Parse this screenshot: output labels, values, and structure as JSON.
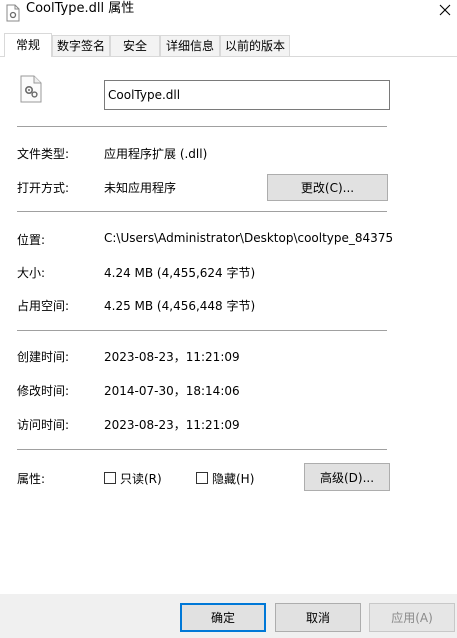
{
  "window": {
    "title": "CoolType.dll 属性",
    "icons": {
      "file": "dll-file-icon",
      "close": "close-icon"
    }
  },
  "tabs": [
    {
      "label": "常规",
      "active": true
    },
    {
      "label": "数字签名"
    },
    {
      "label": "安全"
    },
    {
      "label": "详细信息"
    },
    {
      "label": "以前的版本"
    }
  ],
  "general": {
    "file_name": "CoolType.dll",
    "file_type_label": "文件类型:",
    "file_type_value": "应用程序扩展 (.dll)",
    "opens_with_label": "打开方式:",
    "opens_with_value": "未知应用程序",
    "change_button": "更改(C)...",
    "location_label": "位置:",
    "location_value": "C:\\Users\\Administrator\\Desktop\\cooltype_84375",
    "size_label": "大小:",
    "size_value": "4.24 MB (4,455,624 字节)",
    "size_on_disk_label": "占用空间:",
    "size_on_disk_value": "4.25 MB (4,456,448 字节)",
    "created_label": "创建时间:",
    "created_value": "2023-08-23，11:21:09",
    "modified_label": "修改时间:",
    "modified_value": "2014-07-30，18:14:06",
    "accessed_label": "访问时间:",
    "accessed_value": "2023-08-23，11:21:09",
    "attributes_label": "属性:",
    "readonly_label": "只读(R)",
    "hidden_label": "隐藏(H)",
    "advanced_button": "高级(D)..."
  },
  "footer": {
    "ok": "确定",
    "cancel": "取消",
    "apply": "应用(A)"
  },
  "colors": {
    "accent": "#0078d7",
    "separator": "#a0a0a0"
  }
}
